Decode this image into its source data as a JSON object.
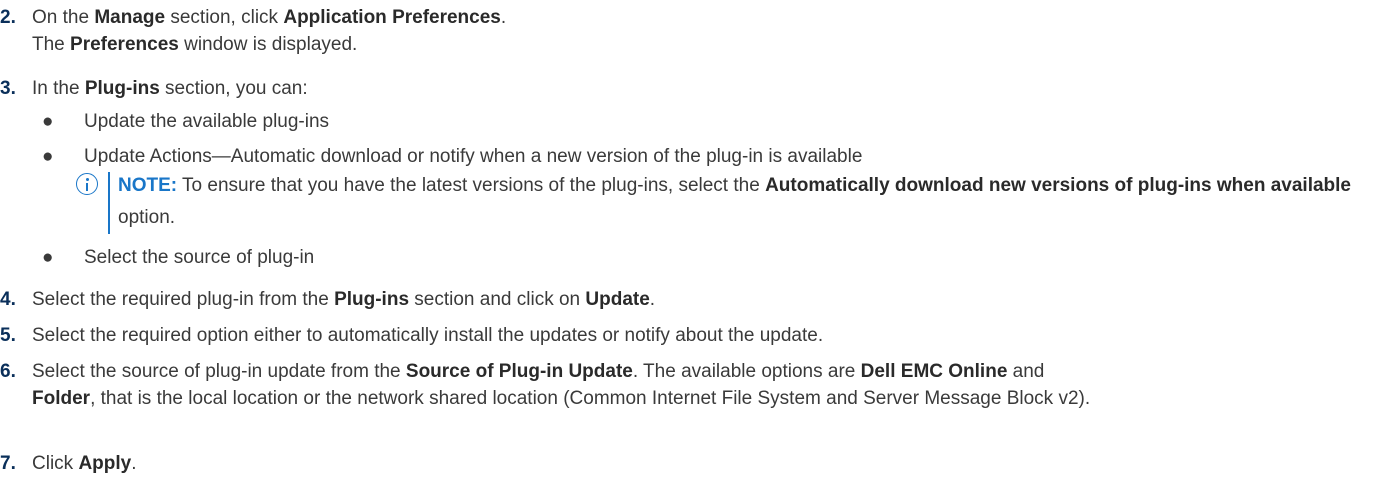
{
  "steps": [
    {
      "num": "2.",
      "pre": "On the ",
      "b1": "Manage",
      "mid": " section, click ",
      "b2": "Application Preferences",
      "post": ".",
      "result_pre": "The ",
      "result_b": "Preferences",
      "result_post": " window is displayed."
    },
    {
      "num": "3.",
      "pre": "In the ",
      "b1": "Plug-ins",
      "post": " section, you can:"
    },
    {
      "num": "4.",
      "pre": "Select the required plug-in from the ",
      "b1": "Plug-ins",
      "mid": " section and click on ",
      "b2": "Update",
      "post": "."
    },
    {
      "num": "5.",
      "text": "Select the required option either to automatically install the updates or notify about the update."
    },
    {
      "num": "6.",
      "pre": "Select the source of plug-in update from the ",
      "b1": "Source of Plug-in Update",
      "mid": ". The available options are ",
      "b2": "Dell EMC Online",
      "mid2": " and",
      "b3": "Folder",
      "post": ", that is the local location or the network shared location (Common Internet File System and Server Message Block v2)."
    },
    {
      "num": "7.",
      "pre": "Click ",
      "b1": "Apply",
      "post": "."
    }
  ],
  "bullets": [
    {
      "dot": "●",
      "text": "Update the available plug-ins"
    },
    {
      "dot": "●",
      "text": "Update Actions—Automatic download or notify when a new version of the plug-in is available"
    },
    {
      "dot": "●",
      "text": "Select the source of plug-in"
    }
  ],
  "note": {
    "icon": "info-icon",
    "label": "NOTE:",
    "pre": " To ensure that you have the latest versions of the plug-ins, select the ",
    "b1": "Automatically download new versions of plug-ins when available",
    "post": " option."
  },
  "colors": {
    "step_number": "#0a2f5a",
    "note_accent": "#1976c8",
    "body_text": "#3a3a3a"
  }
}
